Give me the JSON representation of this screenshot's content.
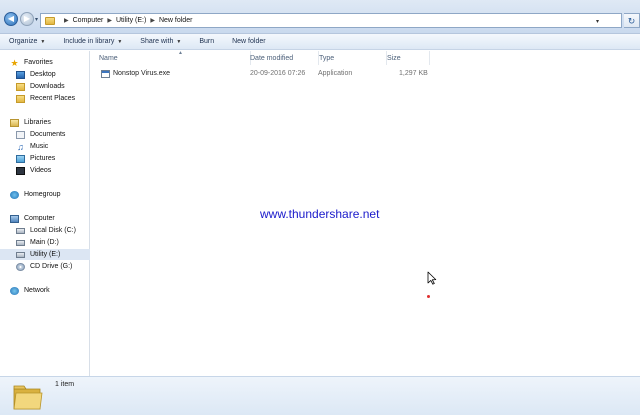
{
  "address": {
    "crumbs": [
      "Computer",
      "Utility (E:)",
      "New folder"
    ]
  },
  "toolbar": {
    "organize": "Organize",
    "include_in_library": "Include in library",
    "share_with": "Share with",
    "burn": "Burn",
    "new_folder": "New folder"
  },
  "nav": {
    "favorites": "Favorites",
    "desktop": "Desktop",
    "downloads": "Downloads",
    "recent_places": "Recent Places",
    "libraries": "Libraries",
    "documents": "Documents",
    "music": "Music",
    "pictures": "Pictures",
    "videos": "Videos",
    "homegroup": "Homegroup",
    "computer": "Computer",
    "local_disk": "Local Disk (C:)",
    "main": "Main (D:)",
    "utility": "Utility (E:)",
    "cd_drive": "CD Drive (G:)",
    "network": "Network"
  },
  "columns": {
    "name": "Name",
    "date_modified": "Date modified",
    "type": "Type",
    "size": "Size"
  },
  "files": [
    {
      "name": "Nonstop Virus.exe",
      "date_modified": "20-09-2016 07:26",
      "type": "Application",
      "size": "1,297 KB"
    }
  ],
  "watermark": "www.thundershare.net",
  "status": {
    "item_count": "1 item"
  },
  "icons": {
    "back": "back-arrow-icon",
    "forward": "forward-arrow-icon",
    "refresh": "refresh-icon"
  }
}
